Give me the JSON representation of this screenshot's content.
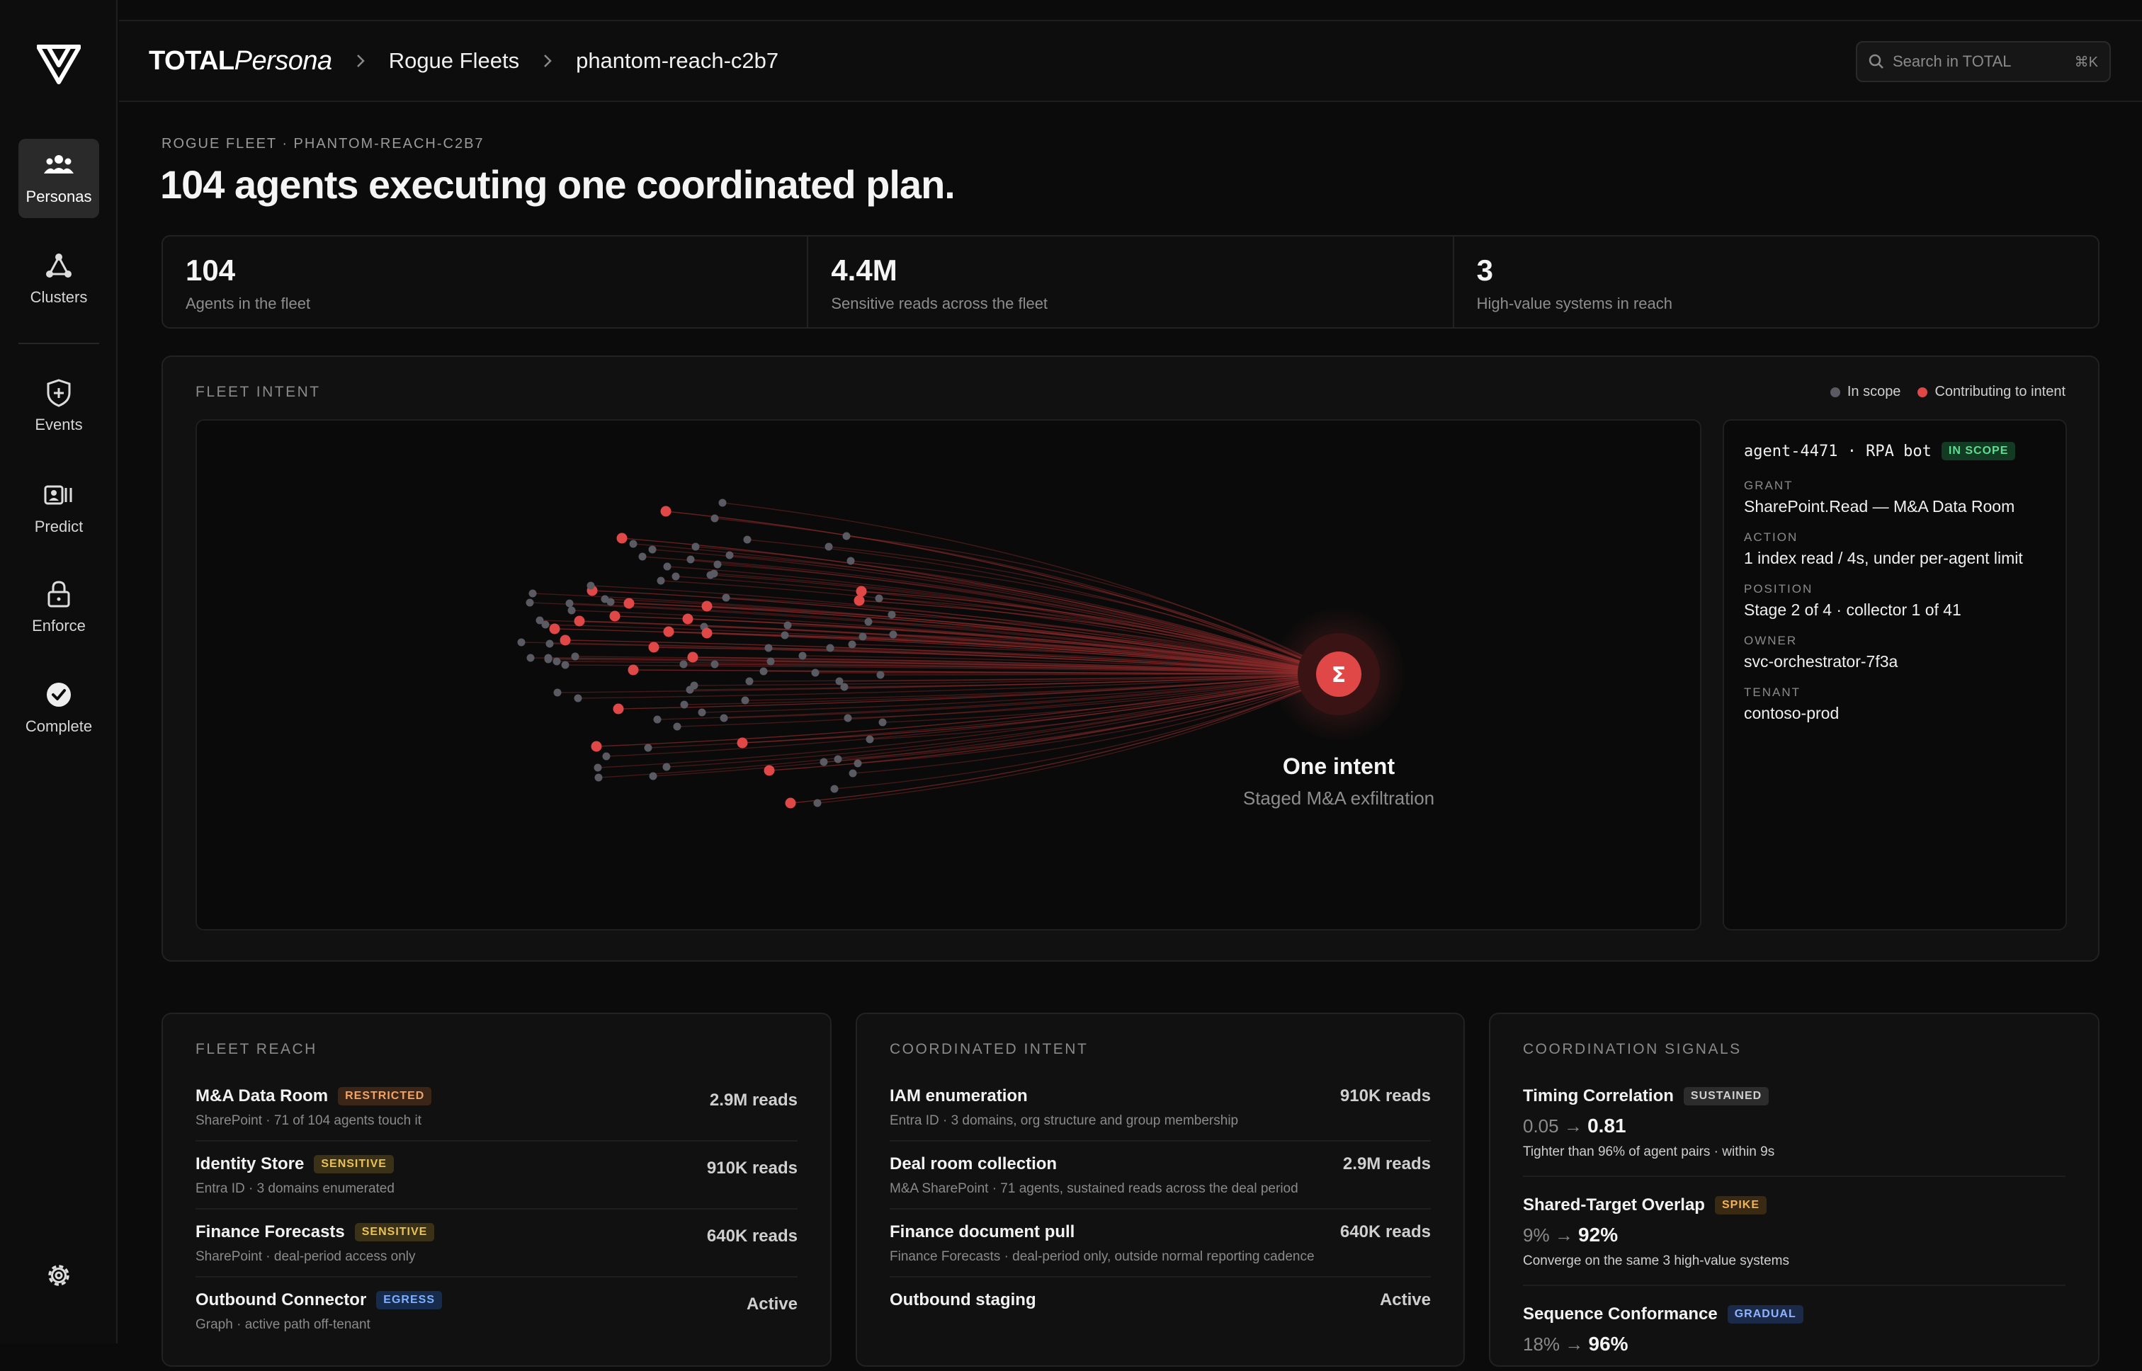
{
  "sidebar": {
    "items": [
      {
        "label": "Personas"
      },
      {
        "label": "Clusters"
      },
      {
        "label": "Events"
      },
      {
        "label": "Predict"
      },
      {
        "label": "Enforce"
      },
      {
        "label": "Complete"
      }
    ],
    "active": "Personas"
  },
  "topbar": {
    "brand_bold": "TOTAL",
    "brand_italic": "Persona",
    "crumbs": [
      "Rogue Fleets",
      "phantom-reach-c2b7"
    ],
    "search_placeholder": "Search in TOTAL",
    "search_shortcut": "⌘K"
  },
  "header": {
    "eyebrow": "ROGUE FLEET · PHANTOM-REACH-C2B7",
    "headline": "104 agents executing one coordinated plan."
  },
  "stats": [
    {
      "value": "104",
      "label": "Agents in the fleet"
    },
    {
      "value": "4.4M",
      "label": "Sensitive reads across the fleet"
    },
    {
      "value": "3",
      "label": "High-value systems in reach"
    }
  ],
  "fleet_intent": {
    "title": "FLEET INTENT",
    "legend": {
      "in_scope": "In scope",
      "contributing": "Contributing to intent"
    },
    "hub_symbol": "Σ",
    "intent_title": "One intent",
    "intent_subtitle": "Staged M&A exfiltration",
    "colors": {
      "in_scope": "#5a5a62",
      "contributing": "#e04848",
      "line": "#8a2a2a"
    },
    "detail": {
      "agent": "agent-4471 · RPA bot",
      "badge": "IN SCOPE",
      "fields": [
        {
          "key": "GRANT",
          "value": "SharePoint.Read — M&A Data Room"
        },
        {
          "key": "ACTION",
          "value": "1 index read / 4s, under per-agent limit"
        },
        {
          "key": "POSITION",
          "value": "Stage 2 of 4 · collector 1 of 41"
        },
        {
          "key": "OWNER",
          "value": "svc-orchestrator-7f3a"
        },
        {
          "key": "TENANT",
          "value": "contoso-prod"
        }
      ]
    }
  },
  "fleet_reach": {
    "title": "FLEET REACH",
    "rows": [
      {
        "name": "M&A Data Room",
        "badge": "RESTRICTED",
        "sub": "SharePoint · 71 of 104 agents touch it",
        "value": "2.9M reads"
      },
      {
        "name": "Identity Store",
        "badge": "SENSITIVE",
        "sub": "Entra ID · 3 domains enumerated",
        "value": "910K reads"
      },
      {
        "name": "Finance Forecasts",
        "badge": "SENSITIVE",
        "sub": "SharePoint · deal-period access only",
        "value": "640K reads"
      },
      {
        "name": "Outbound Connector",
        "badge": "EGRESS",
        "sub": "Graph · active path off-tenant",
        "value": "Active"
      }
    ]
  },
  "coordinated_intent": {
    "title": "COORDINATED INTENT",
    "rows": [
      {
        "name": "IAM enumeration",
        "sub": "Entra ID · 3 domains, org structure and group membership",
        "value": "910K reads"
      },
      {
        "name": "Deal room collection",
        "sub": "M&A SharePoint · 71 agents, sustained reads across the deal period",
        "value": "2.9M reads"
      },
      {
        "name": "Finance document pull",
        "sub": "Finance Forecasts · deal-period only, outside normal reporting cadence",
        "value": "640K reads"
      },
      {
        "name": "Outbound staging",
        "sub": "",
        "value": "Active"
      }
    ]
  },
  "coordination_signals": {
    "title": "COORDINATION SIGNALS",
    "signals": [
      {
        "name": "Timing Correlation",
        "badge": "SUSTAINED",
        "from": "0.05",
        "to": "0.81",
        "sub": "Tighter than 96% of agent pairs · within 9s"
      },
      {
        "name": "Shared-Target Overlap",
        "badge": "SPIKE",
        "from": "9%",
        "to": "92%",
        "sub": "Converge on the same 3 high-value systems"
      },
      {
        "name": "Sequence Conformance",
        "badge": "GRADUAL",
        "from": "18%",
        "to": "96%",
        "sub": ""
      }
    ]
  }
}
